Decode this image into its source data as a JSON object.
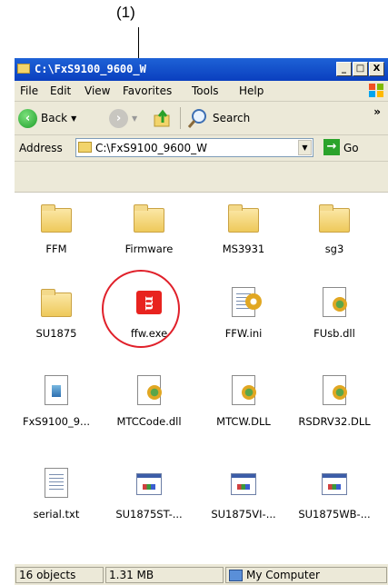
{
  "annotation": {
    "label": "(1)"
  },
  "window": {
    "title": "C:\\FxS9100_9600_W",
    "controls": {
      "minimize": "_",
      "maximize": "□",
      "close": "X"
    }
  },
  "menu": [
    "File",
    "Edit",
    "View",
    "Favorites",
    "Tools",
    "Help"
  ],
  "toolbar": {
    "back_label": "Back",
    "search_label": "Search",
    "more": "»"
  },
  "address": {
    "label": "Address",
    "value": "C:\\FxS9100_9600_W",
    "go_label": "Go"
  },
  "items": [
    {
      "name": "FFM",
      "type": "folder"
    },
    {
      "name": "Firmware",
      "type": "folder"
    },
    {
      "name": "MS3931",
      "type": "folder"
    },
    {
      "name": "sg3",
      "type": "folder"
    },
    {
      "name": "SU1875",
      "type": "folder"
    },
    {
      "name": "ffw.exe",
      "type": "app"
    },
    {
      "name": "FFW.ini",
      "type": "ini"
    },
    {
      "name": "FUsb.dll",
      "type": "dll"
    },
    {
      "name": "FxS9100_9...",
      "type": "data"
    },
    {
      "name": "MTCCode.dll",
      "type": "dll"
    },
    {
      "name": "MTCW.DLL",
      "type": "dll"
    },
    {
      "name": "RSDRV32.DLL",
      "type": "dll"
    },
    {
      "name": "serial.txt",
      "type": "text"
    },
    {
      "name": "SU1875ST-...",
      "type": "exe"
    },
    {
      "name": "SU1875VI-...",
      "type": "exe"
    },
    {
      "name": "SU1875WB-...",
      "type": "exe"
    }
  ],
  "status": {
    "objects": "16 objects",
    "size": "1.31 MB",
    "location": "My Computer"
  },
  "colors": {
    "title_bar": "#0a3fbf",
    "highlight_circle": "#e0202a",
    "app_logo": "#e8231f"
  }
}
